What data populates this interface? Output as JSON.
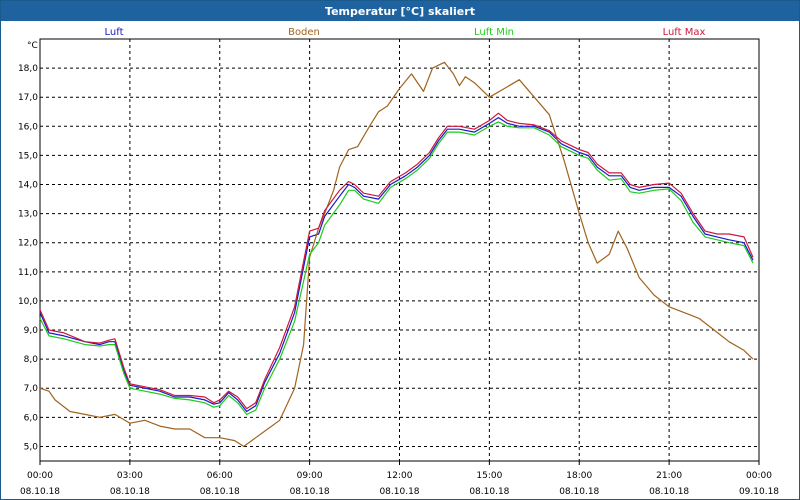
{
  "window": {
    "title": "Temperatur [°C] skaliert"
  },
  "chart_data": {
    "type": "line",
    "title": "Temperatur [°C] skaliert",
    "yunit": "°C",
    "ylim": [
      4.5,
      19
    ],
    "y_ticks": [
      "5,0",
      "6,0",
      "7,0",
      "8,0",
      "9,0",
      "10,0",
      "11,0",
      "12,0",
      "13,0",
      "14,0",
      "15,0",
      "16,0",
      "17,0",
      "18,0"
    ],
    "y_tick_values": [
      5,
      6,
      7,
      8,
      9,
      10,
      11,
      12,
      13,
      14,
      15,
      16,
      17,
      18
    ],
    "x_ticks": [
      {
        "time": "00:00",
        "date": "08.10.18"
      },
      {
        "time": "03:00",
        "date": "08.10.18"
      },
      {
        "time": "06:00",
        "date": "08.10.18"
      },
      {
        "time": "09:00",
        "date": "08.10.18"
      },
      {
        "time": "12:00",
        "date": "08.10.18"
      },
      {
        "time": "15:00",
        "date": "08.10.18"
      },
      {
        "time": "18:00",
        "date": "08.10.18"
      },
      {
        "time": "21:00",
        "date": "08.10.18"
      },
      {
        "time": "00:00",
        "date": "09.10.18"
      }
    ],
    "x_hours_range": [
      0,
      24
    ],
    "grid": true,
    "legend_placement": "top",
    "series": [
      {
        "name": "Luft",
        "color": "#1a1acc",
        "points": [
          [
            0,
            9.6
          ],
          [
            0.3,
            8.9
          ],
          [
            0.8,
            8.8
          ],
          [
            1.5,
            8.6
          ],
          [
            2,
            8.5
          ],
          [
            2.3,
            8.6
          ],
          [
            2.5,
            8.6
          ],
          [
            2.8,
            7.6
          ],
          [
            3,
            7.1
          ],
          [
            3.5,
            7.0
          ],
          [
            4,
            6.9
          ],
          [
            4.5,
            6.7
          ],
          [
            5,
            6.7
          ],
          [
            5.5,
            6.6
          ],
          [
            5.8,
            6.45
          ],
          [
            6,
            6.5
          ],
          [
            6.3,
            6.85
          ],
          [
            6.6,
            6.6
          ],
          [
            6.9,
            6.2
          ],
          [
            7.2,
            6.4
          ],
          [
            7.5,
            7.2
          ],
          [
            8,
            8.2
          ],
          [
            8.5,
            9.6
          ],
          [
            9,
            12.2
          ],
          [
            9.3,
            12.3
          ],
          [
            9.5,
            12.9
          ],
          [
            10,
            13.6
          ],
          [
            10.3,
            14.0
          ],
          [
            10.5,
            13.9
          ],
          [
            10.8,
            13.6
          ],
          [
            11.3,
            13.5
          ],
          [
            11.7,
            14.0
          ],
          [
            12.2,
            14.3
          ],
          [
            12.6,
            14.6
          ],
          [
            13,
            15.0
          ],
          [
            13.3,
            15.5
          ],
          [
            13.6,
            15.9
          ],
          [
            14,
            15.9
          ],
          [
            14.5,
            15.8
          ],
          [
            15,
            16.1
          ],
          [
            15.3,
            16.3
          ],
          [
            15.6,
            16.1
          ],
          [
            16,
            16.0
          ],
          [
            16.5,
            16.0
          ],
          [
            17,
            15.8
          ],
          [
            17.4,
            15.4
          ],
          [
            18,
            15.1
          ],
          [
            18.3,
            15.0
          ],
          [
            18.6,
            14.6
          ],
          [
            19,
            14.3
          ],
          [
            19.4,
            14.3
          ],
          [
            19.7,
            13.9
          ],
          [
            20,
            13.8
          ],
          [
            20.5,
            13.9
          ],
          [
            21,
            13.9
          ],
          [
            21.4,
            13.6
          ],
          [
            21.8,
            12.9
          ],
          [
            22.2,
            12.3
          ],
          [
            22.6,
            12.2
          ],
          [
            23,
            12.1
          ],
          [
            23.5,
            12.0
          ],
          [
            23.8,
            11.4
          ]
        ]
      },
      {
        "name": "Boden",
        "color": "#a0641e",
        "points": [
          [
            0,
            7.0
          ],
          [
            0.3,
            6.9
          ],
          [
            0.5,
            6.6
          ],
          [
            1,
            6.2
          ],
          [
            1.5,
            6.1
          ],
          [
            2,
            6.0
          ],
          [
            2.5,
            6.1
          ],
          [
            3,
            5.8
          ],
          [
            3.5,
            5.9
          ],
          [
            4,
            5.7
          ],
          [
            4.5,
            5.6
          ],
          [
            5,
            5.6
          ],
          [
            5.5,
            5.3
          ],
          [
            6,
            5.3
          ],
          [
            6.5,
            5.2
          ],
          [
            6.8,
            5.0
          ],
          [
            7.2,
            5.3
          ],
          [
            7.6,
            5.6
          ],
          [
            8,
            5.9
          ],
          [
            8.5,
            7.0
          ],
          [
            8.8,
            8.5
          ],
          [
            9,
            11.5
          ],
          [
            9.3,
            12.5
          ],
          [
            9.5,
            13.0
          ],
          [
            9.8,
            13.8
          ],
          [
            10,
            14.6
          ],
          [
            10.3,
            15.2
          ],
          [
            10.6,
            15.3
          ],
          [
            11,
            16.0
          ],
          [
            11.3,
            16.5
          ],
          [
            11.6,
            16.7
          ],
          [
            12,
            17.3
          ],
          [
            12.4,
            17.8
          ],
          [
            12.8,
            17.2
          ],
          [
            13.1,
            18.0
          ],
          [
            13.5,
            18.2
          ],
          [
            13.8,
            17.8
          ],
          [
            14,
            17.4
          ],
          [
            14.2,
            17.7
          ],
          [
            14.5,
            17.5
          ],
          [
            15,
            17.0
          ],
          [
            15.5,
            17.3
          ],
          [
            16,
            17.6
          ],
          [
            16.5,
            17.0
          ],
          [
            17,
            16.4
          ],
          [
            17.5,
            14.8
          ],
          [
            18,
            13.0
          ],
          [
            18.3,
            12.0
          ],
          [
            18.6,
            11.3
          ],
          [
            19,
            11.6
          ],
          [
            19.3,
            12.4
          ],
          [
            19.6,
            11.8
          ],
          [
            20,
            10.8
          ],
          [
            20.5,
            10.2
          ],
          [
            21,
            9.8
          ],
          [
            21.5,
            9.6
          ],
          [
            22,
            9.4
          ],
          [
            22.5,
            9.0
          ],
          [
            23,
            8.6
          ],
          [
            23.5,
            8.3
          ],
          [
            23.8,
            8.0
          ]
        ]
      },
      {
        "name": "Luft Min",
        "color": "#1acc1a",
        "points": [
          [
            0,
            9.4
          ],
          [
            0.3,
            8.8
          ],
          [
            0.8,
            8.7
          ],
          [
            1.5,
            8.5
          ],
          [
            2,
            8.45
          ],
          [
            2.3,
            8.5
          ],
          [
            2.5,
            8.5
          ],
          [
            2.8,
            7.5
          ],
          [
            3,
            7.0
          ],
          [
            3.5,
            6.9
          ],
          [
            4,
            6.8
          ],
          [
            4.5,
            6.65
          ],
          [
            5,
            6.6
          ],
          [
            5.5,
            6.5
          ],
          [
            5.8,
            6.35
          ],
          [
            6,
            6.4
          ],
          [
            6.3,
            6.75
          ],
          [
            6.6,
            6.5
          ],
          [
            6.9,
            6.1
          ],
          [
            7.2,
            6.25
          ],
          [
            7.5,
            7.0
          ],
          [
            8,
            8.0
          ],
          [
            8.5,
            9.3
          ],
          [
            9,
            11.6
          ],
          [
            9.3,
            12.0
          ],
          [
            9.5,
            12.6
          ],
          [
            10,
            13.3
          ],
          [
            10.3,
            13.8
          ],
          [
            10.5,
            13.8
          ],
          [
            10.8,
            13.5
          ],
          [
            11.3,
            13.35
          ],
          [
            11.7,
            13.9
          ],
          [
            12.2,
            14.2
          ],
          [
            12.6,
            14.5
          ],
          [
            13,
            14.9
          ],
          [
            13.3,
            15.4
          ],
          [
            13.6,
            15.8
          ],
          [
            14,
            15.8
          ],
          [
            14.5,
            15.7
          ],
          [
            15,
            16.0
          ],
          [
            15.3,
            16.15
          ],
          [
            15.6,
            16.0
          ],
          [
            16,
            15.95
          ],
          [
            16.5,
            15.95
          ],
          [
            17,
            15.7
          ],
          [
            17.4,
            15.3
          ],
          [
            18,
            15.0
          ],
          [
            18.3,
            14.9
          ],
          [
            18.6,
            14.5
          ],
          [
            19,
            14.15
          ],
          [
            19.4,
            14.2
          ],
          [
            19.7,
            13.75
          ],
          [
            20,
            13.7
          ],
          [
            20.5,
            13.8
          ],
          [
            21,
            13.85
          ],
          [
            21.4,
            13.45
          ],
          [
            21.8,
            12.7
          ],
          [
            22.2,
            12.2
          ],
          [
            22.6,
            12.1
          ],
          [
            23,
            12.0
          ],
          [
            23.5,
            11.9
          ],
          [
            23.8,
            11.3
          ]
        ]
      },
      {
        "name": "Luft Max",
        "color": "#cc1a3c",
        "points": [
          [
            0,
            9.7
          ],
          [
            0.3,
            9.0
          ],
          [
            0.8,
            8.9
          ],
          [
            1.5,
            8.6
          ],
          [
            2,
            8.55
          ],
          [
            2.3,
            8.65
          ],
          [
            2.5,
            8.7
          ],
          [
            2.8,
            7.7
          ],
          [
            3,
            7.15
          ],
          [
            3.5,
            7.05
          ],
          [
            4,
            6.95
          ],
          [
            4.5,
            6.75
          ],
          [
            5,
            6.75
          ],
          [
            5.5,
            6.7
          ],
          [
            5.8,
            6.5
          ],
          [
            6,
            6.6
          ],
          [
            6.3,
            6.9
          ],
          [
            6.6,
            6.7
          ],
          [
            6.9,
            6.3
          ],
          [
            7.2,
            6.5
          ],
          [
            7.5,
            7.3
          ],
          [
            8,
            8.4
          ],
          [
            8.5,
            9.8
          ],
          [
            9,
            12.4
          ],
          [
            9.3,
            12.5
          ],
          [
            9.5,
            13.1
          ],
          [
            10,
            13.8
          ],
          [
            10.3,
            14.1
          ],
          [
            10.5,
            14.0
          ],
          [
            10.8,
            13.7
          ],
          [
            11.3,
            13.6
          ],
          [
            11.7,
            14.1
          ],
          [
            12.2,
            14.4
          ],
          [
            12.6,
            14.7
          ],
          [
            13,
            15.1
          ],
          [
            13.3,
            15.6
          ],
          [
            13.6,
            16.0
          ],
          [
            14,
            16.0
          ],
          [
            14.5,
            15.9
          ],
          [
            15,
            16.2
          ],
          [
            15.3,
            16.45
          ],
          [
            15.6,
            16.2
          ],
          [
            16,
            16.1
          ],
          [
            16.5,
            16.05
          ],
          [
            17,
            15.85
          ],
          [
            17.4,
            15.5
          ],
          [
            18,
            15.2
          ],
          [
            18.3,
            15.1
          ],
          [
            18.6,
            14.7
          ],
          [
            19,
            14.4
          ],
          [
            19.4,
            14.4
          ],
          [
            19.7,
            14.0
          ],
          [
            20,
            13.9
          ],
          [
            20.5,
            14.0
          ],
          [
            21,
            14.05
          ],
          [
            21.4,
            13.7
          ],
          [
            21.8,
            13.0
          ],
          [
            22.2,
            12.4
          ],
          [
            22.6,
            12.3
          ],
          [
            23,
            12.3
          ],
          [
            23.5,
            12.2
          ],
          [
            23.8,
            11.5
          ]
        ]
      }
    ]
  }
}
